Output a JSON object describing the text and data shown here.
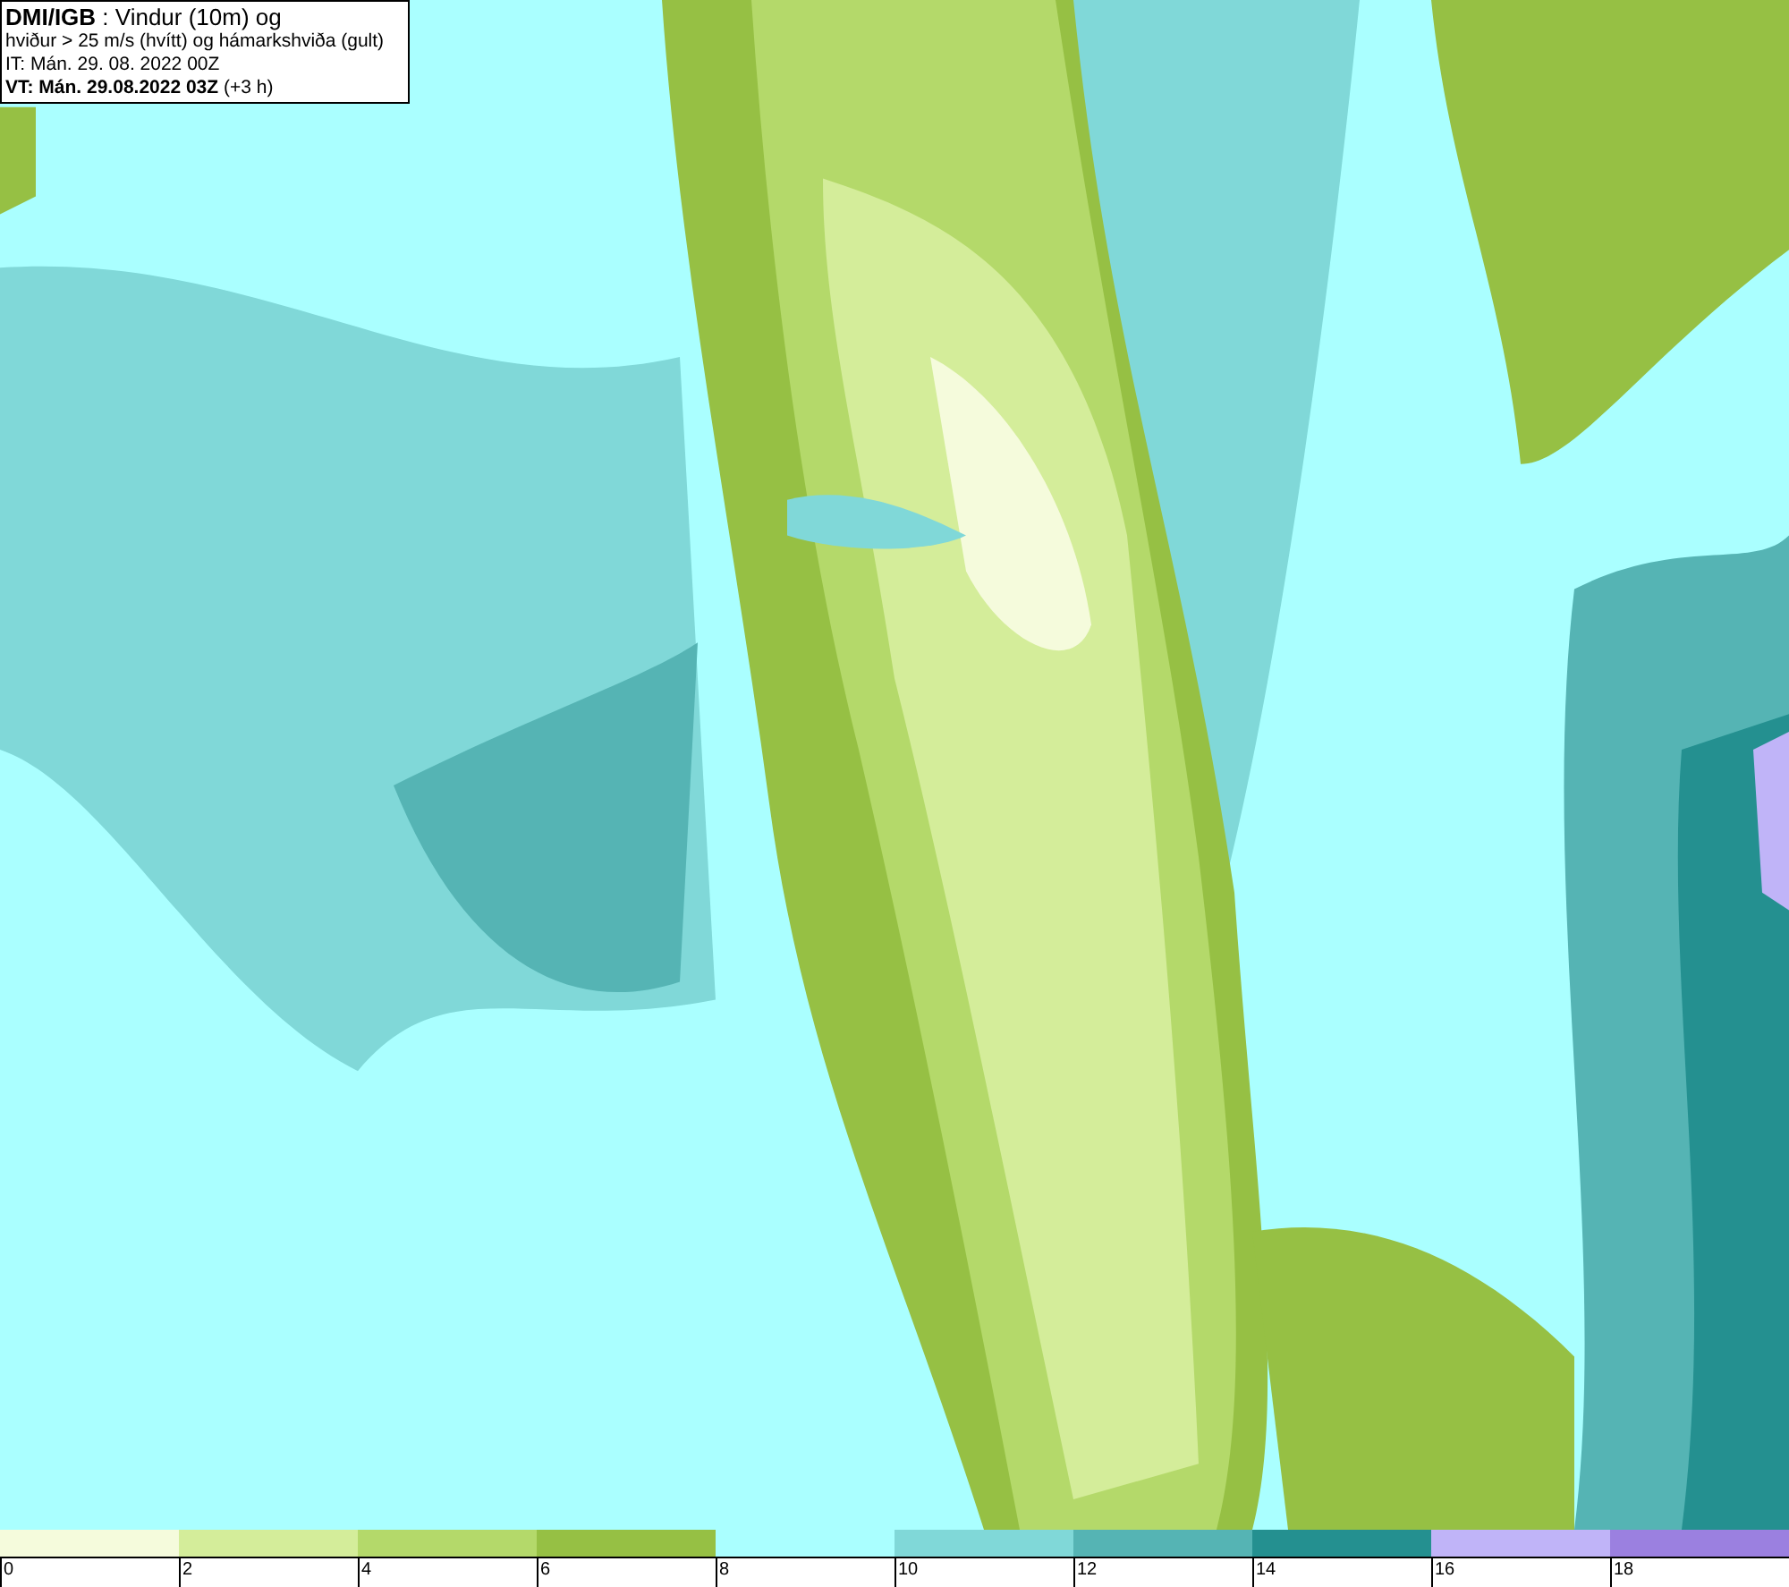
{
  "header": {
    "lines": [
      "**DMI/IGB** : Vindur (10m) og",
      "hviður > 25 m/s (hvítt) og hámarkshviða (gult)",
      "IT: Mán. 29. 08. 2022 00Z",
      "**VT: Mán. 29.08.2022 03Z** (+3 h)"
    ]
  },
  "legend": [
    {
      "label": "0",
      "color": "#f5fbdc"
    },
    {
      "label": "2",
      "color": "#d4ed9a"
    },
    {
      "label": "4",
      "color": "#b4d96a"
    },
    {
      "label": "6",
      "color": "#96c044"
    },
    {
      "label": "8",
      "color": "#aaffff"
    },
    {
      "label": "10",
      "color": "#80d8d8"
    },
    {
      "label": "12",
      "color": "#55b4b4"
    },
    {
      "label": "14",
      "color": "#249090"
    },
    {
      "label": "16",
      "color": "#c0b4f8"
    },
    {
      "label": "18",
      "color": "#9b80e0"
    }
  ]
}
